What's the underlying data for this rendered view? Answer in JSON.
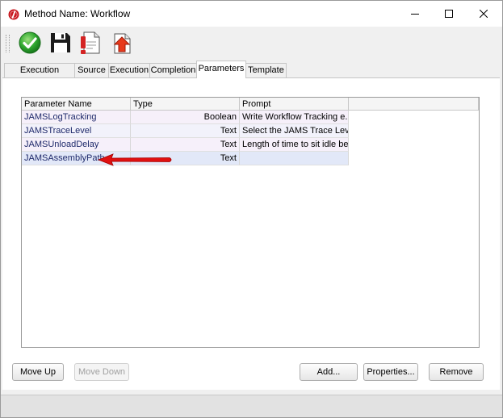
{
  "window": {
    "title": "Method Name: Workflow",
    "controls": [
      "minimize",
      "maximize",
      "close"
    ]
  },
  "toolbar": {
    "buttons": [
      {
        "icon": "check-icon",
        "tooltip": "Save and Close"
      },
      {
        "icon": "floppy-disk-icon",
        "tooltip": "Save"
      },
      {
        "icon": "document-info-icon",
        "tooltip": "Properties"
      },
      {
        "icon": "document-upload-icon",
        "tooltip": "Export"
      }
    ]
  },
  "tabs": [
    {
      "label": "Execution Method",
      "active": false
    },
    {
      "label": "Source",
      "active": false
    },
    {
      "label": "Execution",
      "active": false
    },
    {
      "label": "Completion",
      "active": false
    },
    {
      "label": "Parameters",
      "active": true
    },
    {
      "label": "Template",
      "active": false
    }
  ],
  "grid": {
    "columns": [
      "Parameter Name",
      "Type",
      "Prompt",
      ""
    ],
    "rows": [
      {
        "name": "JAMSLogTracking",
        "type": "Boolean",
        "prompt": "Write Workflow Tracking e..."
      },
      {
        "name": "JAMSTraceLevel",
        "type": "Text",
        "prompt": "Select the JAMS Trace Level:"
      },
      {
        "name": "JAMSUnloadDelay",
        "type": "Text",
        "prompt": "Length of time to sit idle be..."
      },
      {
        "name": "JAMSAssemblyPath",
        "type": "Text",
        "prompt": ""
      }
    ],
    "row_colors": [
      "#f6f0fa",
      "#f2f2fb",
      "#f6f0fa",
      "#e2e8f8"
    ]
  },
  "buttons": {
    "move_up": "Move Up",
    "move_down": "Move Down",
    "add": "Add...",
    "properties": "Properties...",
    "remove": "Remove"
  },
  "colors": {
    "annotation_arrow": "#e01010",
    "check_green": "#2fa830",
    "selected_row": "#e2e8f8"
  }
}
